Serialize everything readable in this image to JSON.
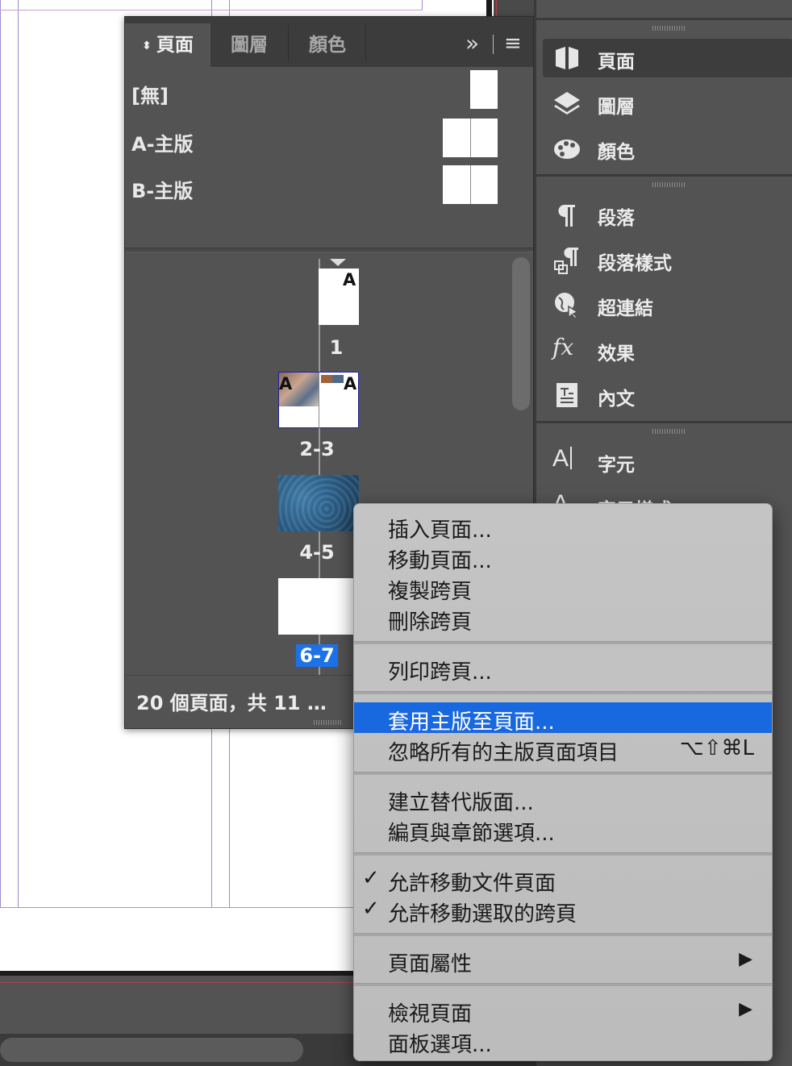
{
  "pages_panel": {
    "tabs": [
      {
        "label": "頁面",
        "active": true
      },
      {
        "label": "圖層",
        "active": false
      },
      {
        "label": "顏色",
        "active": false
      }
    ],
    "collapse_glyph": "»",
    "menu_glyph": "≡",
    "tab_updown_glyph": "⬍",
    "masters": [
      {
        "label": "[無]"
      },
      {
        "label": "A-主版"
      },
      {
        "label": "B-主版"
      }
    ],
    "spreads": [
      {
        "label": "1",
        "selected": false,
        "master_letters": [
          "A"
        ]
      },
      {
        "label": "2-3",
        "selected": false,
        "master_letters": [
          "A",
          "A"
        ]
      },
      {
        "label": "4-5",
        "selected": false,
        "master_letters": []
      },
      {
        "label": "6-7",
        "selected": true,
        "master_letters": []
      }
    ],
    "footer": "20 個頁面，共 11 …"
  },
  "dock": {
    "groups": [
      [
        {
          "label": "頁面",
          "icon": "pages-icon",
          "active": true
        },
        {
          "label": "圖層",
          "icon": "layers-icon",
          "active": false
        },
        {
          "label": "顏色",
          "icon": "color-palette-icon",
          "active": false
        }
      ],
      [
        {
          "label": "段落",
          "icon": "paragraph-icon",
          "active": false
        },
        {
          "label": "段落樣式",
          "icon": "paragraph-styles-icon",
          "active": false
        },
        {
          "label": "超連結",
          "icon": "hyperlinks-icon",
          "active": false
        },
        {
          "label": "效果",
          "icon": "effects-icon",
          "active": false
        },
        {
          "label": "內文",
          "icon": "text-wrap-icon",
          "active": false
        }
      ],
      [
        {
          "label": "字元",
          "icon": "character-icon",
          "active": false
        },
        {
          "label": "字元樣式",
          "icon": "character-styles-icon",
          "active": false
        }
      ]
    ]
  },
  "context_menu": {
    "sections": [
      [
        {
          "label": "插入頁面..."
        },
        {
          "label": "移動頁面..."
        },
        {
          "label": "複製跨頁"
        },
        {
          "label": "刪除跨頁"
        }
      ],
      [
        {
          "label": "列印跨頁..."
        }
      ],
      [
        {
          "label": "套用主版至頁面...",
          "highlighted": true
        },
        {
          "label": "忽略所有的主版頁面項目",
          "shortcut": "⌥⇧⌘L"
        }
      ],
      [
        {
          "label": "建立替代版面..."
        },
        {
          "label": "編頁與章節選項..."
        }
      ],
      [
        {
          "label": "允許移動文件頁面",
          "checked": true
        },
        {
          "label": "允許移動選取的跨頁",
          "checked": true
        }
      ],
      [
        {
          "label": "頁面屬性",
          "submenu": true
        }
      ],
      [
        {
          "label": "檢視頁面",
          "submenu": true
        },
        {
          "label": "面板選項..."
        }
      ]
    ],
    "check_glyph": "✓",
    "submenu_glyph": "▶"
  },
  "colors": {
    "selection": "#1d72e8",
    "menu_highlight": "#1868e0",
    "guide_purple": "#9a8ad8",
    "bleed_red": "#b83c4c"
  }
}
